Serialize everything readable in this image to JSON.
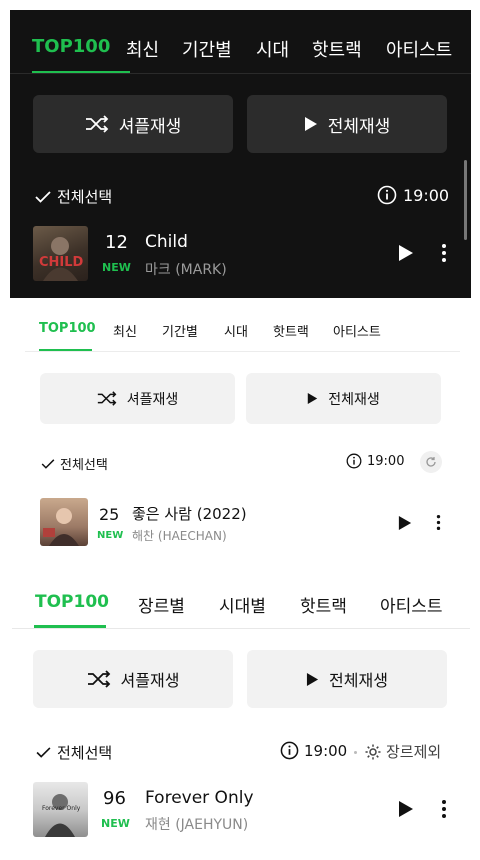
{
  "panel1": {
    "tabs": [
      "TOP100",
      "최신",
      "기간별",
      "시대",
      "핫트랙",
      "아티스트"
    ],
    "shuffle_label": "셔플재생",
    "play_all_label": "전체재생",
    "select_all_label": "전체선택",
    "time": "19:00",
    "track": {
      "rank": "12",
      "badge": "NEW",
      "title": "Child",
      "artist": "마크 (MARK)"
    }
  },
  "panel2": {
    "tabs": [
      "TOP100",
      "최신",
      "기간별",
      "시대",
      "핫트랙",
      "아티스트"
    ],
    "shuffle_label": "셔플재생",
    "play_all_label": "전체재생",
    "select_all_label": "전체선택",
    "time": "19:00",
    "track": {
      "rank": "25",
      "badge": "NEW",
      "title": "좋은 사람 (2022)",
      "artist": "해찬 (HAECHAN)"
    }
  },
  "panel3": {
    "tabs": [
      "TOP100",
      "장르별",
      "시대별",
      "핫트랙",
      "아티스트"
    ],
    "shuffle_label": "셔플재생",
    "play_all_label": "전체재생",
    "select_all_label": "전체선택",
    "time": "19:00",
    "genre_exclude_label": "장르제외",
    "track": {
      "rank": "96",
      "badge": "NEW",
      "title": "Forever Only",
      "artist": "재현 (JAEHYUN)"
    }
  },
  "colors": {
    "accent": "#1fbf4f",
    "dark_bg": "#121212",
    "dark_button": "#2c2c2c",
    "light_button": "#f2f2f2"
  }
}
